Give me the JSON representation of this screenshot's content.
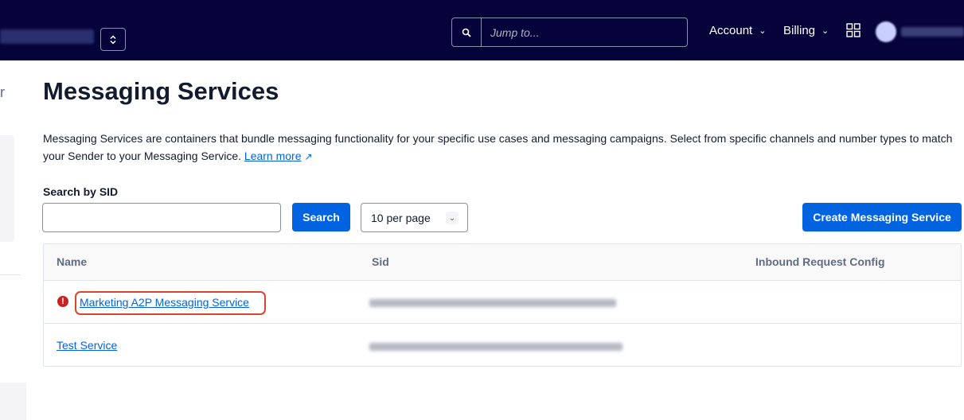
{
  "topbar": {
    "account_switcher_icon": "chevron-up-down-icon",
    "jump_placeholder": "Jump to...",
    "account_menu": "Account",
    "billing_menu": "Billing"
  },
  "sidebar": {
    "partial_text": "r"
  },
  "page": {
    "title": "Messaging Services",
    "description": "Messaging Services are containers that bundle messaging functionality for your specific use cases and messaging campaigns. Select from specific channels and number types to match your Sender to your Messaging Service.",
    "learn_more": "Learn more"
  },
  "search": {
    "label": "Search by SID",
    "value": "",
    "button": "Search"
  },
  "per_page": {
    "selected": "10 per page"
  },
  "create_button": "Create Messaging Service",
  "table": {
    "headers": [
      "Name",
      "Sid",
      "Inbound Request Config"
    ],
    "rows": [
      {
        "name": "Marketing A2P Messaging Service",
        "status_icon": "error-icon",
        "highlighted": true
      },
      {
        "name": "Test Service",
        "status_icon": "",
        "highlighted": false
      }
    ]
  },
  "colors": {
    "topbar_bg": "#06033a",
    "primary": "#0263e0",
    "error": "#c72323",
    "highlight": "#d6452f"
  }
}
